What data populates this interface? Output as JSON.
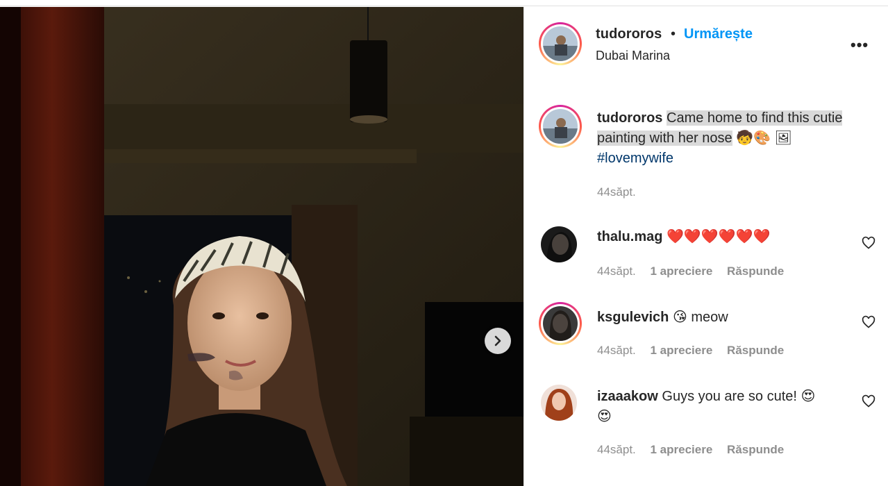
{
  "post": {
    "username": "tudororos",
    "separator": "•",
    "follow_label": "Urmărește",
    "location": "Dubai Marina",
    "more_label": "•••",
    "caption": {
      "username": "tudororos",
      "text_highlighted_1": "Came home to find this cutie",
      "text_highlighted_2": "painting with her nose",
      "emojis": "🧒🎨 🖼",
      "hashtag": "#lovemywife",
      "time": "44săpt."
    }
  },
  "comments": [
    {
      "username": "thalu.mag",
      "text": "❤️❤️❤️❤️❤️❤️",
      "time": "44săpt.",
      "likes": "1 apreciere",
      "reply": "Răspunde"
    },
    {
      "username": "ksgulevich",
      "text": "😘 meow",
      "time": "44săpt.",
      "likes": "1 apreciere",
      "reply": "Răspunde"
    },
    {
      "username": "izaaakow",
      "text": "Guys you are so cute! 😍",
      "text_line2": "😍",
      "time": "44săpt.",
      "likes": "1 apreciere",
      "reply": "Răspunde"
    }
  ],
  "icons": {
    "next": "chevron-right-icon",
    "like": "heart-outline-icon",
    "more": "more-options-icon"
  },
  "colors": {
    "follow": "#0095f6",
    "hashtag": "#00376b",
    "meta": "#8e8e8e",
    "highlight": "#d9d9d9"
  }
}
